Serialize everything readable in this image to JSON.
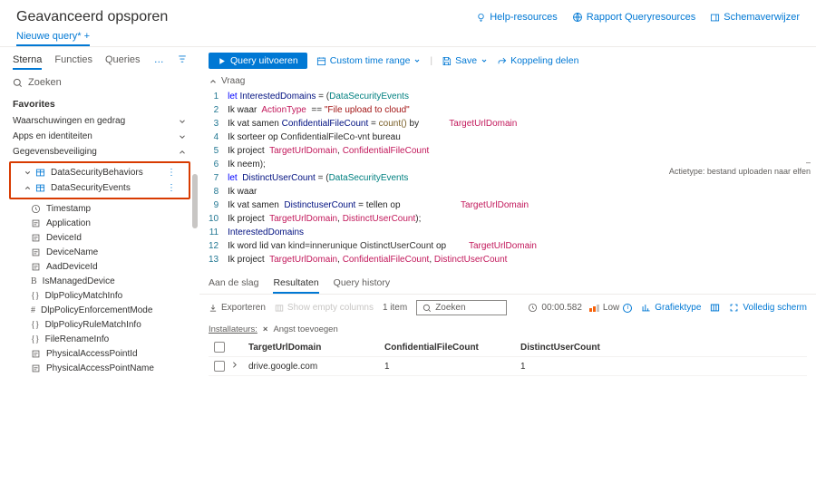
{
  "header": {
    "title": "Geavanceerd opsporen",
    "help": "Help-resources",
    "report": "Rapport Queryresources",
    "schema": "Schemaverwijzer"
  },
  "newquery": "Nieuwe query*  +",
  "sidebar": {
    "tabs": [
      "Sterna",
      "Functies",
      "Queries"
    ],
    "search": "Zoeken",
    "categories": [
      {
        "label": "Favorites"
      },
      {
        "label": "Waarschuwingen en gedrag"
      },
      {
        "label": "Apps en identiteiten"
      },
      {
        "label": "Gegevensbeveiliging"
      }
    ],
    "highlight": [
      "DataSecurityBehaviors",
      "DataSecurityEvents"
    ],
    "fields": [
      "Timestamp",
      "Application",
      "DeviceId",
      "DeviceName",
      "AadDeviceId",
      "IsManagedDevice",
      "DlpPolicyMatchInfo",
      "DlpPolicyEnforcementMode",
      "DlpPolicyRuleMatchInfo",
      "FileRenameInfo",
      "PhysicalAccessPointId",
      "PhysicalAccessPointName"
    ]
  },
  "toolbar": {
    "run": "Query uitvoeren",
    "timerange": "Custom time range",
    "save": "Save",
    "share": "Koppeling delen"
  },
  "editor": {
    "label": "Vraag",
    "lines": [
      "let InterestedDomains = (DataSecurityEvents",
      "Ik waar  ActionType  == \"File upload to cloud\"",
      "Ik vat samen ConfidentialFileCount = count() by            TargetUrlDomain",
      "Ik sorteer op ConfidentialFileCo-vnt bureau",
      "Ik project  TargetUrlDomain, ConfidentialFileCount",
      "Ik neem);",
      "let  DistinctUserCount = (DataSecurityEvents",
      "Ik waar",
      "Ik vat samen  DistinctuserCount = tellen op                     TargetUrlDomain",
      "Ik project  TargetUrlDomain, DistinctUserCount);",
      "InterestedDomains",
      "Ik word lid van kind=innerunique OistinctUserCount op         TargetUrlDomain",
      "Ik project  TargetUrlDomain, ConfidentialFileCount, DistinctUserCount"
    ]
  },
  "note": {
    "dash": "–",
    "text": "Actietype: bestand uploaden naar elfen"
  },
  "results": {
    "tabs": [
      "Aan de slag",
      "Resultaten",
      "Query history"
    ],
    "export": "Exporteren",
    "showempty": "Show empty columns",
    "itemcount": "1 item",
    "searchph": "Zoeken",
    "time": "00:00.582",
    "level": "Low",
    "chart": "Grafiektype",
    "fullscreen": "Volledig scherm",
    "installers": "Installateurs:",
    "addfear": "Angst toevoegen",
    "headers": [
      "TargetUrlDomain",
      "ConfidentialFileCount",
      "DistinctUserCount"
    ],
    "row": {
      "domain": "drive.google.com",
      "count": "1",
      "users": "1"
    }
  }
}
